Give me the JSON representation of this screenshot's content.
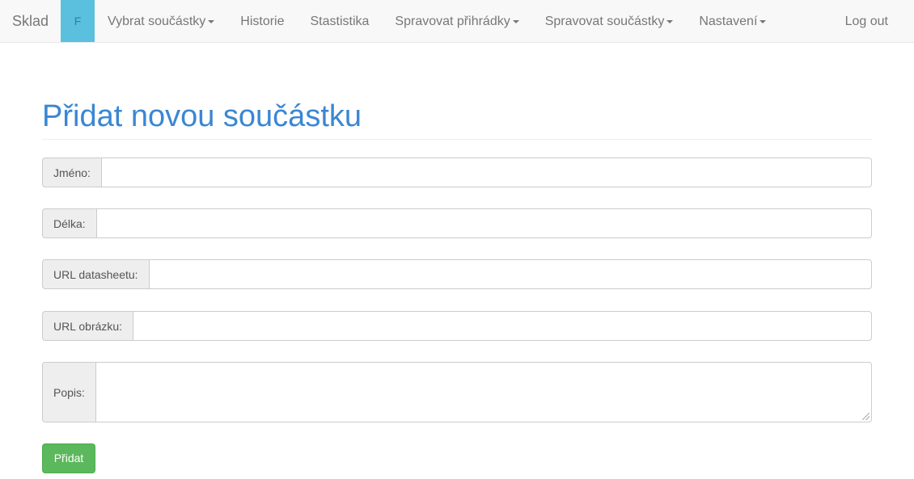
{
  "navbar": {
    "brand": "Sklad",
    "badge": "F",
    "items": [
      {
        "label": "Vybrat součástky",
        "dropdown": true
      },
      {
        "label": "Historie",
        "dropdown": false
      },
      {
        "label": "Stastistika",
        "dropdown": false
      },
      {
        "label": "Spravovat přihrádky",
        "dropdown": true
      },
      {
        "label": "Spravovat součástky",
        "dropdown": true
      },
      {
        "label": "Nastavení",
        "dropdown": true
      }
    ],
    "logout": "Log out"
  },
  "form": {
    "title": "Přidat novou součástku",
    "fields": {
      "name": {
        "label": "Jméno:",
        "value": ""
      },
      "length": {
        "label": "Délka:",
        "value": ""
      },
      "datasheet": {
        "label": "URL datasheetu:",
        "value": ""
      },
      "image": {
        "label": "URL obrázku:",
        "value": ""
      },
      "description": {
        "label": "Popis:",
        "value": ""
      }
    },
    "submit_label": "Přidat"
  },
  "colors": {
    "title": "#3a87d3",
    "badge": "#5bc0de",
    "submit": "#5cb85c"
  }
}
